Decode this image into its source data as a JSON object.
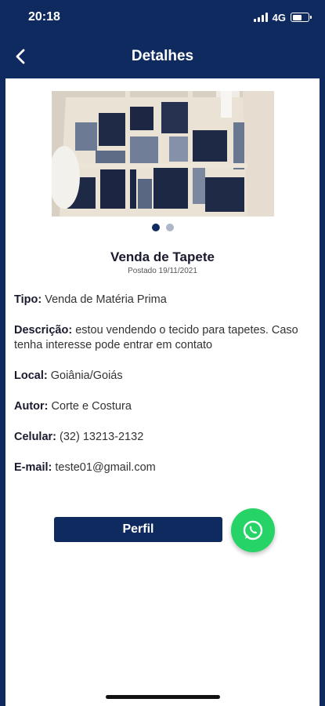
{
  "status_bar": {
    "time": "20:18",
    "network": "4G",
    "battery_level": 0.6
  },
  "header": {
    "title": "Detalhes",
    "back_icon": "chevron-left-icon"
  },
  "carousel": {
    "total_images": 2,
    "active_index": 0
  },
  "ad": {
    "title": "Venda de Tapete",
    "posted": "Postado 19/11/2021",
    "details": [
      {
        "label": "Tipo:",
        "value": "Venda de Matéria Prima"
      },
      {
        "label": "Descrição:",
        "value": "estou vendendo o tecido para tapetes. Caso tenha interesse pode entrar em contato"
      },
      {
        "label": "Local:",
        "value": "Goiânia/Goiás"
      },
      {
        "label": "Autor:",
        "value": "Corte e Costura"
      },
      {
        "label": "Celular:",
        "value": "(32) 13213-2132"
      },
      {
        "label": "E-mail:",
        "value": "teste01@gmail.com"
      }
    ]
  },
  "actions": {
    "profile_label": "Perfil",
    "whatsapp_icon": "whatsapp-icon"
  },
  "colors": {
    "primary": "#0e2a5e",
    "whatsapp": "#25d366",
    "background": "#ffffff"
  }
}
